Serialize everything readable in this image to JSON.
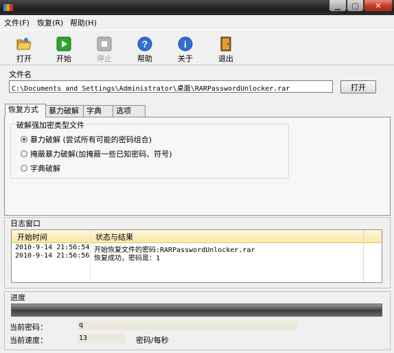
{
  "window": {
    "min_glyph": "▁",
    "max_glyph": "▢",
    "close_glyph": "✕"
  },
  "menu": [
    "文件(F)",
    "恢复(R)",
    "帮助(H)"
  ],
  "toolbar": {
    "open": "打开",
    "start": "开始",
    "stop": "停止",
    "help": "帮助",
    "about": "关于",
    "exit": "退出"
  },
  "file": {
    "label": "文件名",
    "path": "C:\\Documents and Settings\\Administrator\\桌面\\RARPasswordUnlocker.rar",
    "open_button": "打开"
  },
  "tabs": [
    "恢复方式",
    "暴力破解",
    "字典",
    "选项"
  ],
  "active_tab": 0,
  "recovery": {
    "group_title": "破解强加密类型文件",
    "options": [
      {
        "label": "暴力破解 (尝试所有可能的密码组合)",
        "checked": true
      },
      {
        "label": "掩蔽暴力破解(加掩蔽一些已知密码、符号)",
        "checked": false
      },
      {
        "label": "字典破解",
        "checked": false
      }
    ]
  },
  "log": {
    "label": "日志窗口",
    "col_time": "开始时间",
    "col_status": "状态与结果",
    "rows": [
      {
        "time": "2010-9-14 21:56:54",
        "status": "开始恢复文件的密码:RARPasswordUnlocker.rar"
      },
      {
        "time": "2010-9-14 21:56:56",
        "status": "恢复成功，密码是：1"
      }
    ]
  },
  "progress": {
    "label": "进度",
    "value": 0,
    "current_password_label": "当前密码：",
    "current_password": "q",
    "current_speed_label": "当前速度：",
    "current_speed": "13",
    "speed_unit": "密码/每秒"
  },
  "colors": {
    "log_header": "#fbe7a8",
    "value_box": "#eae8d8"
  }
}
